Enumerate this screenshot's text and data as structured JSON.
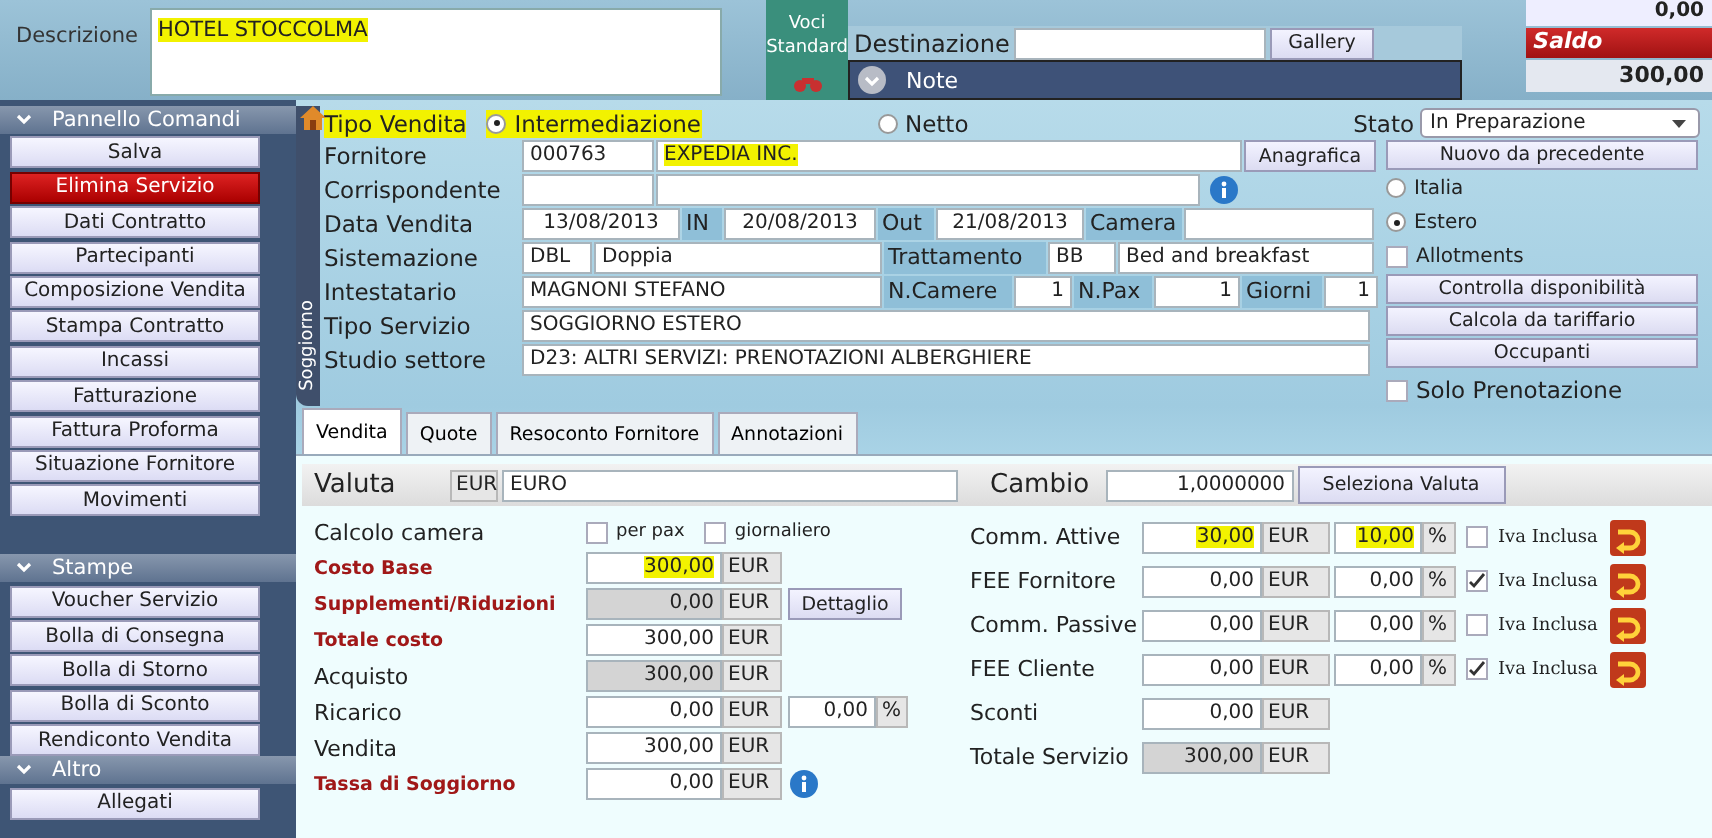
{
  "descrizione": {
    "label": "Descrizione",
    "value": "HOTEL STOCCOLMA",
    "highlighted": true
  },
  "voci_standard": {
    "label": "Voci Standard"
  },
  "destinazione": {
    "label": "Destinazione",
    "button": "Gallery"
  },
  "note": {
    "label": "Note"
  },
  "saldo": {
    "top_value": "0,00",
    "label": "Saldo",
    "value": "300,00"
  },
  "sidebar": {
    "sections": [
      {
        "title": "Pannello Comandi",
        "items": [
          {
            "label": "Salva",
            "kind": "normal"
          },
          {
            "label": "Elimina Servizio",
            "kind": "danger"
          },
          {
            "label": "Dati Contratto",
            "kind": "normal"
          },
          {
            "label": "Partecipanti",
            "kind": "normal"
          },
          {
            "label": "Composizione Vendita",
            "kind": "normal"
          },
          {
            "label": "Stampa Contratto",
            "kind": "normal"
          },
          {
            "label": "Incassi",
            "kind": "normal"
          },
          {
            "label": "Fatturazione",
            "kind": "normal"
          },
          {
            "label": "Fattura Proforma",
            "kind": "normal"
          },
          {
            "label": "Situazione Fornitore",
            "kind": "normal"
          },
          {
            "label": "Movimenti",
            "kind": "normal"
          }
        ]
      },
      {
        "title": "Stampe",
        "items": [
          {
            "label": "Voucher Servizio",
            "kind": "normal"
          },
          {
            "label": "Bolla di Consegna",
            "kind": "normal"
          },
          {
            "label": "Bolla di Storno",
            "kind": "normal"
          },
          {
            "label": "Bolla di Sconto",
            "kind": "normal"
          },
          {
            "label": "Rendiconto Vendita",
            "kind": "normal"
          }
        ]
      },
      {
        "title": "Altro",
        "items": [
          {
            "label": "Allegati",
            "kind": "normal"
          }
        ]
      }
    ]
  },
  "soggiorno": {
    "tab_label": "Soggiorno",
    "tipo_vendita": {
      "label": "Tipo Vendita",
      "highlighted": true,
      "options": [
        {
          "label": "Intermediazione",
          "selected": true,
          "highlighted": true
        },
        {
          "label": "Netto",
          "selected": false,
          "highlighted": false
        }
      ]
    },
    "stato": {
      "label": "Stato",
      "value": "In Preparazione"
    },
    "fornitore": {
      "label": "Fornitore",
      "code": "000763",
      "name": "EXPEDIA INC.",
      "name_highlighted": true,
      "button": "Anagrafica"
    },
    "corrispondente": {
      "label": "Corrispondente"
    },
    "data_vendita": {
      "label": "Data Vendita",
      "value": "13/08/2013",
      "in_label": "IN",
      "in_value": "20/08/2013",
      "out_label": "Out",
      "out_value": "21/08/2013",
      "camera_label": "Camera"
    },
    "sistemazione": {
      "label": "Sistemazione",
      "code": "DBL",
      "value": "Doppia",
      "trattamento_label": "Trattamento",
      "trattamento_code": "BB",
      "trattamento_value": "Bed and breakfast"
    },
    "intestatario": {
      "label": "Intestatario",
      "value": "MAGNONI STEFANO",
      "camere_label": "N.Camere",
      "camere": "1",
      "pax_label": "N.Pax",
      "pax": "1",
      "giorni_label": "Giorni",
      "giorni": "1"
    },
    "tipo_servizio": {
      "label": "Tipo Servizio",
      "value": "SOGGIORNO ESTERO"
    },
    "studio_settore": {
      "label": "Studio settore",
      "value": "D23: ALTRI SERVIZI: PRENOTAZIONI ALBERGHIERE"
    },
    "nuovo_button": "Nuovo da precedente",
    "destination_options": [
      {
        "label": "Italia",
        "selected": false
      },
      {
        "label": "Estero",
        "selected": true
      }
    ],
    "allotments": {
      "label": "Allotments",
      "checked": false
    },
    "actions": [
      "Controlla disponibilità",
      "Calcola da tariffario",
      "Occupanti"
    ],
    "solo_prenotazione": {
      "label": "Solo Prenotazione",
      "checked": false
    }
  },
  "tabs": [
    {
      "label": "Vendita",
      "selected": true
    },
    {
      "label": "Quote",
      "selected": false
    },
    {
      "label": "Resoconto Fornitore",
      "selected": false
    },
    {
      "label": "Annotazioni",
      "selected": false
    }
  ],
  "valuta": {
    "label": "Valuta",
    "code": "EUR",
    "name": "EURO",
    "cambio_label": "Cambio",
    "cambio": "1,0000000",
    "button": "Seleziona Valuta"
  },
  "calcolo_camera": {
    "label": "Calcolo camera",
    "options": [
      {
        "label": "per pax",
        "checked": false
      },
      {
        "label": "giornaliero",
        "checked": false
      }
    ]
  },
  "costs": [
    {
      "label": "Costo Base",
      "value": "300,00",
      "currency": "EUR",
      "emphasis": true,
      "readonly": false,
      "highlighted": true
    },
    {
      "label": "Supplementi/Riduzioni",
      "value": "0,00",
      "currency": "EUR",
      "emphasis": true,
      "readonly": true,
      "highlighted": false,
      "extra": {
        "kind": "button",
        "label": "Dettaglio"
      }
    },
    {
      "label": "Totale costo",
      "value": "300,00",
      "currency": "EUR",
      "emphasis": true,
      "readonly": false,
      "highlighted": false
    },
    {
      "label": "Acquisto",
      "value": "300,00",
      "currency": "EUR",
      "emphasis": false,
      "readonly": true,
      "highlighted": false
    },
    {
      "label": "Ricarico",
      "value": "0,00",
      "currency": "EUR",
      "emphasis": false,
      "readonly": false,
      "highlighted": false,
      "extra": {
        "kind": "percent",
        "value": "0,00",
        "unit": "%"
      }
    },
    {
      "label": "Vendita",
      "value": "300,00",
      "currency": "EUR",
      "emphasis": false,
      "readonly": false,
      "highlighted": false
    },
    {
      "label": "Tassa di Soggiorno",
      "value": "0,00",
      "currency": "EUR",
      "emphasis": true,
      "readonly": false,
      "highlighted": false,
      "extra": {
        "kind": "info"
      }
    }
  ],
  "commissions": [
    {
      "kind": "commission",
      "label": "Comm. Attive",
      "value": "30,00",
      "currency": "EUR",
      "percent": "10,00",
      "unit": "%",
      "iva_label": "Iva Inclusa",
      "iva_checked": false,
      "highlighted": true,
      "readonly": false
    },
    {
      "kind": "commission",
      "label": "FEE Fornitore",
      "value": "0,00",
      "currency": "EUR",
      "percent": "0,00",
      "unit": "%",
      "iva_label": "Iva Inclusa",
      "iva_checked": true,
      "highlighted": false,
      "readonly": false
    },
    {
      "kind": "commission",
      "label": "Comm. Passive",
      "value": "0,00",
      "currency": "EUR",
      "percent": "0,00",
      "unit": "%",
      "iva_label": "Iva Inclusa",
      "iva_checked": false,
      "highlighted": false,
      "readonly": false
    },
    {
      "kind": "commission",
      "label": "FEE Cliente",
      "value": "0,00",
      "currency": "EUR",
      "percent": "0,00",
      "unit": "%",
      "iva_label": "Iva Inclusa",
      "iva_checked": true,
      "highlighted": false,
      "readonly": false
    },
    {
      "kind": "amount",
      "label": "Sconti",
      "value": "0,00",
      "currency": "EUR",
      "highlighted": false,
      "readonly": false
    },
    {
      "kind": "amount",
      "label": "Totale Servizio",
      "value": "300,00",
      "currency": "EUR",
      "highlighted": false,
      "readonly": true
    }
  ]
}
